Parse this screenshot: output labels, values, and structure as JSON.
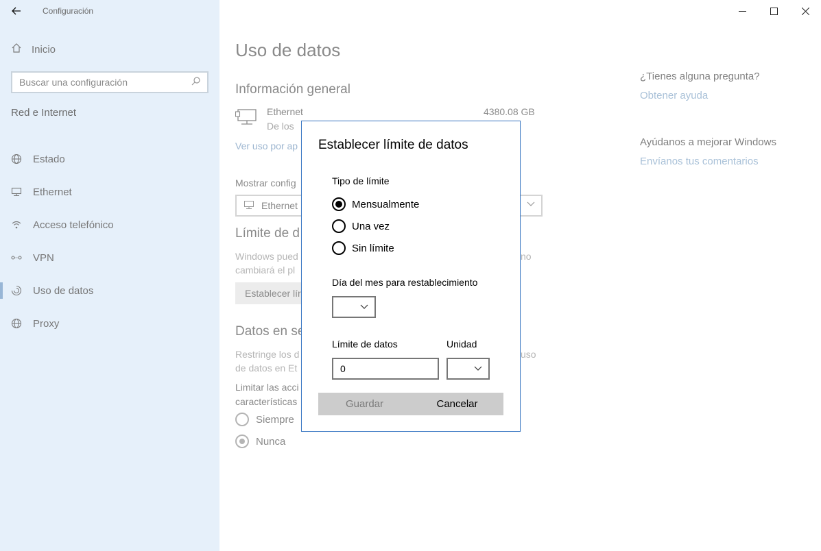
{
  "window": {
    "app_title": "Configuración",
    "controls": [
      "minimize-icon",
      "maximize-icon",
      "close-icon"
    ]
  },
  "sidebar": {
    "home_label": "Inicio",
    "search_placeholder": "Buscar una configuración",
    "section_title": "Red e Internet",
    "items": [
      {
        "label": "Estado",
        "icon": "globe-icon",
        "active": false
      },
      {
        "label": "Ethernet",
        "icon": "monitor-icon",
        "active": false
      },
      {
        "label": "Acceso telefónico",
        "icon": "dialup-icon",
        "active": false
      },
      {
        "label": "VPN",
        "icon": "vpn-icon",
        "active": false
      },
      {
        "label": "Uso de datos",
        "icon": "data-usage-icon",
        "active": true
      },
      {
        "label": "Proxy",
        "icon": "globe-icon",
        "active": false
      }
    ]
  },
  "main": {
    "page_title": "Uso de datos",
    "overview_heading": "Información general",
    "ethernet_name": "Ethernet",
    "ethernet_sub": "De los",
    "ethernet_value": "4380.08 GB",
    "usage_link": "Ver uso por ap",
    "show_settings_label": "Mostrar config",
    "network_select_value": "Ethernet",
    "limit_heading": "Límite de d",
    "limit_desc_line1": "Windows pued",
    "limit_desc_line1_end": "no",
    "limit_desc_line2": "cambiará el pl",
    "limit_button": "Establecer lír",
    "background_heading": "Datos en se",
    "bg_desc_line1": "Restringe los d",
    "bg_desc_line1_end": "uso",
    "bg_desc_line2": "de datos en Et",
    "limit_actions_line1": "Limitar las acci",
    "limit_actions_line2": "características",
    "radio_always": "Siempre",
    "radio_never": "Nunca"
  },
  "right": {
    "question": "¿Tienes alguna pregunta?",
    "help_link": "Obtener ayuda",
    "improve": "Ayúdanos a mejorar Windows",
    "feedback_link": "Envíanos tus comentarios"
  },
  "dialog": {
    "title": "Establecer límite de datos",
    "type_label": "Tipo de límite",
    "options": [
      {
        "label": "Mensualmente",
        "selected": true
      },
      {
        "label": "Una vez",
        "selected": false
      },
      {
        "label": "Sin límite",
        "selected": false
      }
    ],
    "reset_day_label": "Día del mes para restablecimiento",
    "reset_day_value": "",
    "data_limit_label": "Límite de datos",
    "data_limit_value": "0",
    "unit_label": "Unidad",
    "unit_value": "",
    "save_button": "Guardar",
    "cancel_button": "Cancelar"
  }
}
